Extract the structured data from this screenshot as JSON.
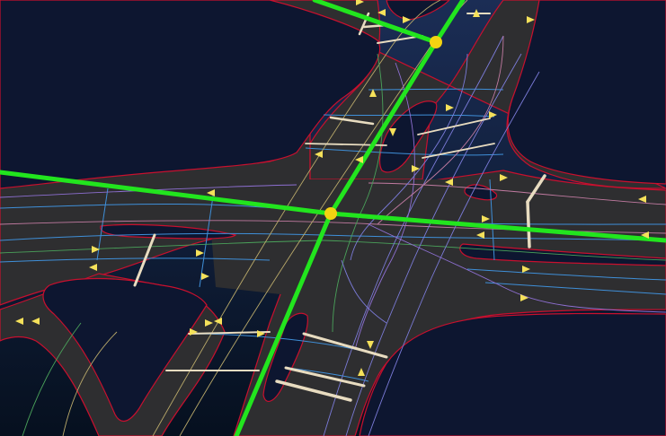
{
  "scene": {
    "background_top": "#1b2d55",
    "background_bottom": "#06101f",
    "road_fill": "#2e2e30",
    "road_edge": "#c8102e",
    "lane_line": "#3f8fd8",
    "route_color": "#22e51e",
    "junction_color": "#f3d311",
    "arrow_color": "#f5e15a",
    "stop_line_color": "#e8dcc0",
    "centerline_colors": [
      "#b9a96a",
      "#7b7bd8",
      "#4aa15a",
      "#c07aa0",
      "#8d6fd1"
    ]
  }
}
